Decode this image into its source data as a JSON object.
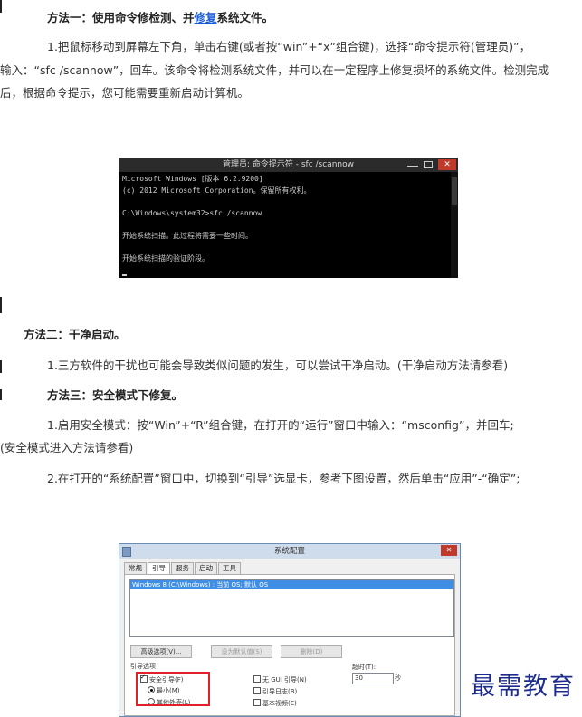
{
  "method1": {
    "heading_pre": "方法一：使用命令修检测、并",
    "heading_link": "修复",
    "heading_post": "系统文件。",
    "para_line1": "1.把鼠标移动到屏幕左下角，单击右键(或者按“win”+“x”组合键)，选择“命令提示符(管理员)”，",
    "para_line2": "输入：“sfc /scannow”，回车。该命令将检测系统文件，并可以在一定程序上修复损坏的系统文件。检测完成",
    "para_line3": "后，根据命令提示，您可能需要重新启动计算机。"
  },
  "cmd_window": {
    "title": "管理员: 命令提示符 - sfc  /scannow",
    "lines": [
      "Microsoft Windows [版本 6.2.9200]",
      "(c) 2012 Microsoft Corporation。保留所有权利。",
      "",
      "C:\\Windows\\system32>sfc /scannow",
      "",
      "开始系统扫描。此过程将需要一些时间。",
      "",
      "开始系统扫描的验证阶段。"
    ],
    "close_glyph": "✕"
  },
  "method2": {
    "heading": "方法二：干净启动。",
    "para": "1.三方软件的干扰也可能会导致类似问题的发生，可以尝试干净启动。(干净启动方法请参看)"
  },
  "method3": {
    "heading": "方法三：安全模式下修复。",
    "para1_line1": "1.启用安全模式：按“Win”+“R”组合键，在打开的“运行”窗口中输入：“msconfig”，并回车;",
    "para1_line2": "(安全模式进入方法请参看)",
    "para2": "2.在打开的“系统配置”窗口中，切换到“引导”选显卡，参考下图设置，然后单击“应用”-“确定”;"
  },
  "msconfig": {
    "title": "系统配置",
    "close_glyph": "✕",
    "tabs": [
      "常规",
      "引导",
      "服务",
      "启动",
      "工具"
    ],
    "os_entry": "Windows 8 (C:\\Windows) : 当前 OS; 默认 OS",
    "btn_advanced": "高级选项(V)...",
    "btn_default": "设为默认值(S)",
    "btn_delete": "删除(D)",
    "group_label": "引导选项",
    "safe_boot": "安全引导(F)",
    "minimal": "最小(M)",
    "other_shell": "其他外壳(L)",
    "no_gui": "无 GUI 引导(N)",
    "boot_log": "引导日志(B)",
    "base_video": "基本视频(E)",
    "timeout_label": "超时(T):",
    "timeout_value": "30",
    "timeout_unit": "秒"
  },
  "watermark": "最需教育"
}
